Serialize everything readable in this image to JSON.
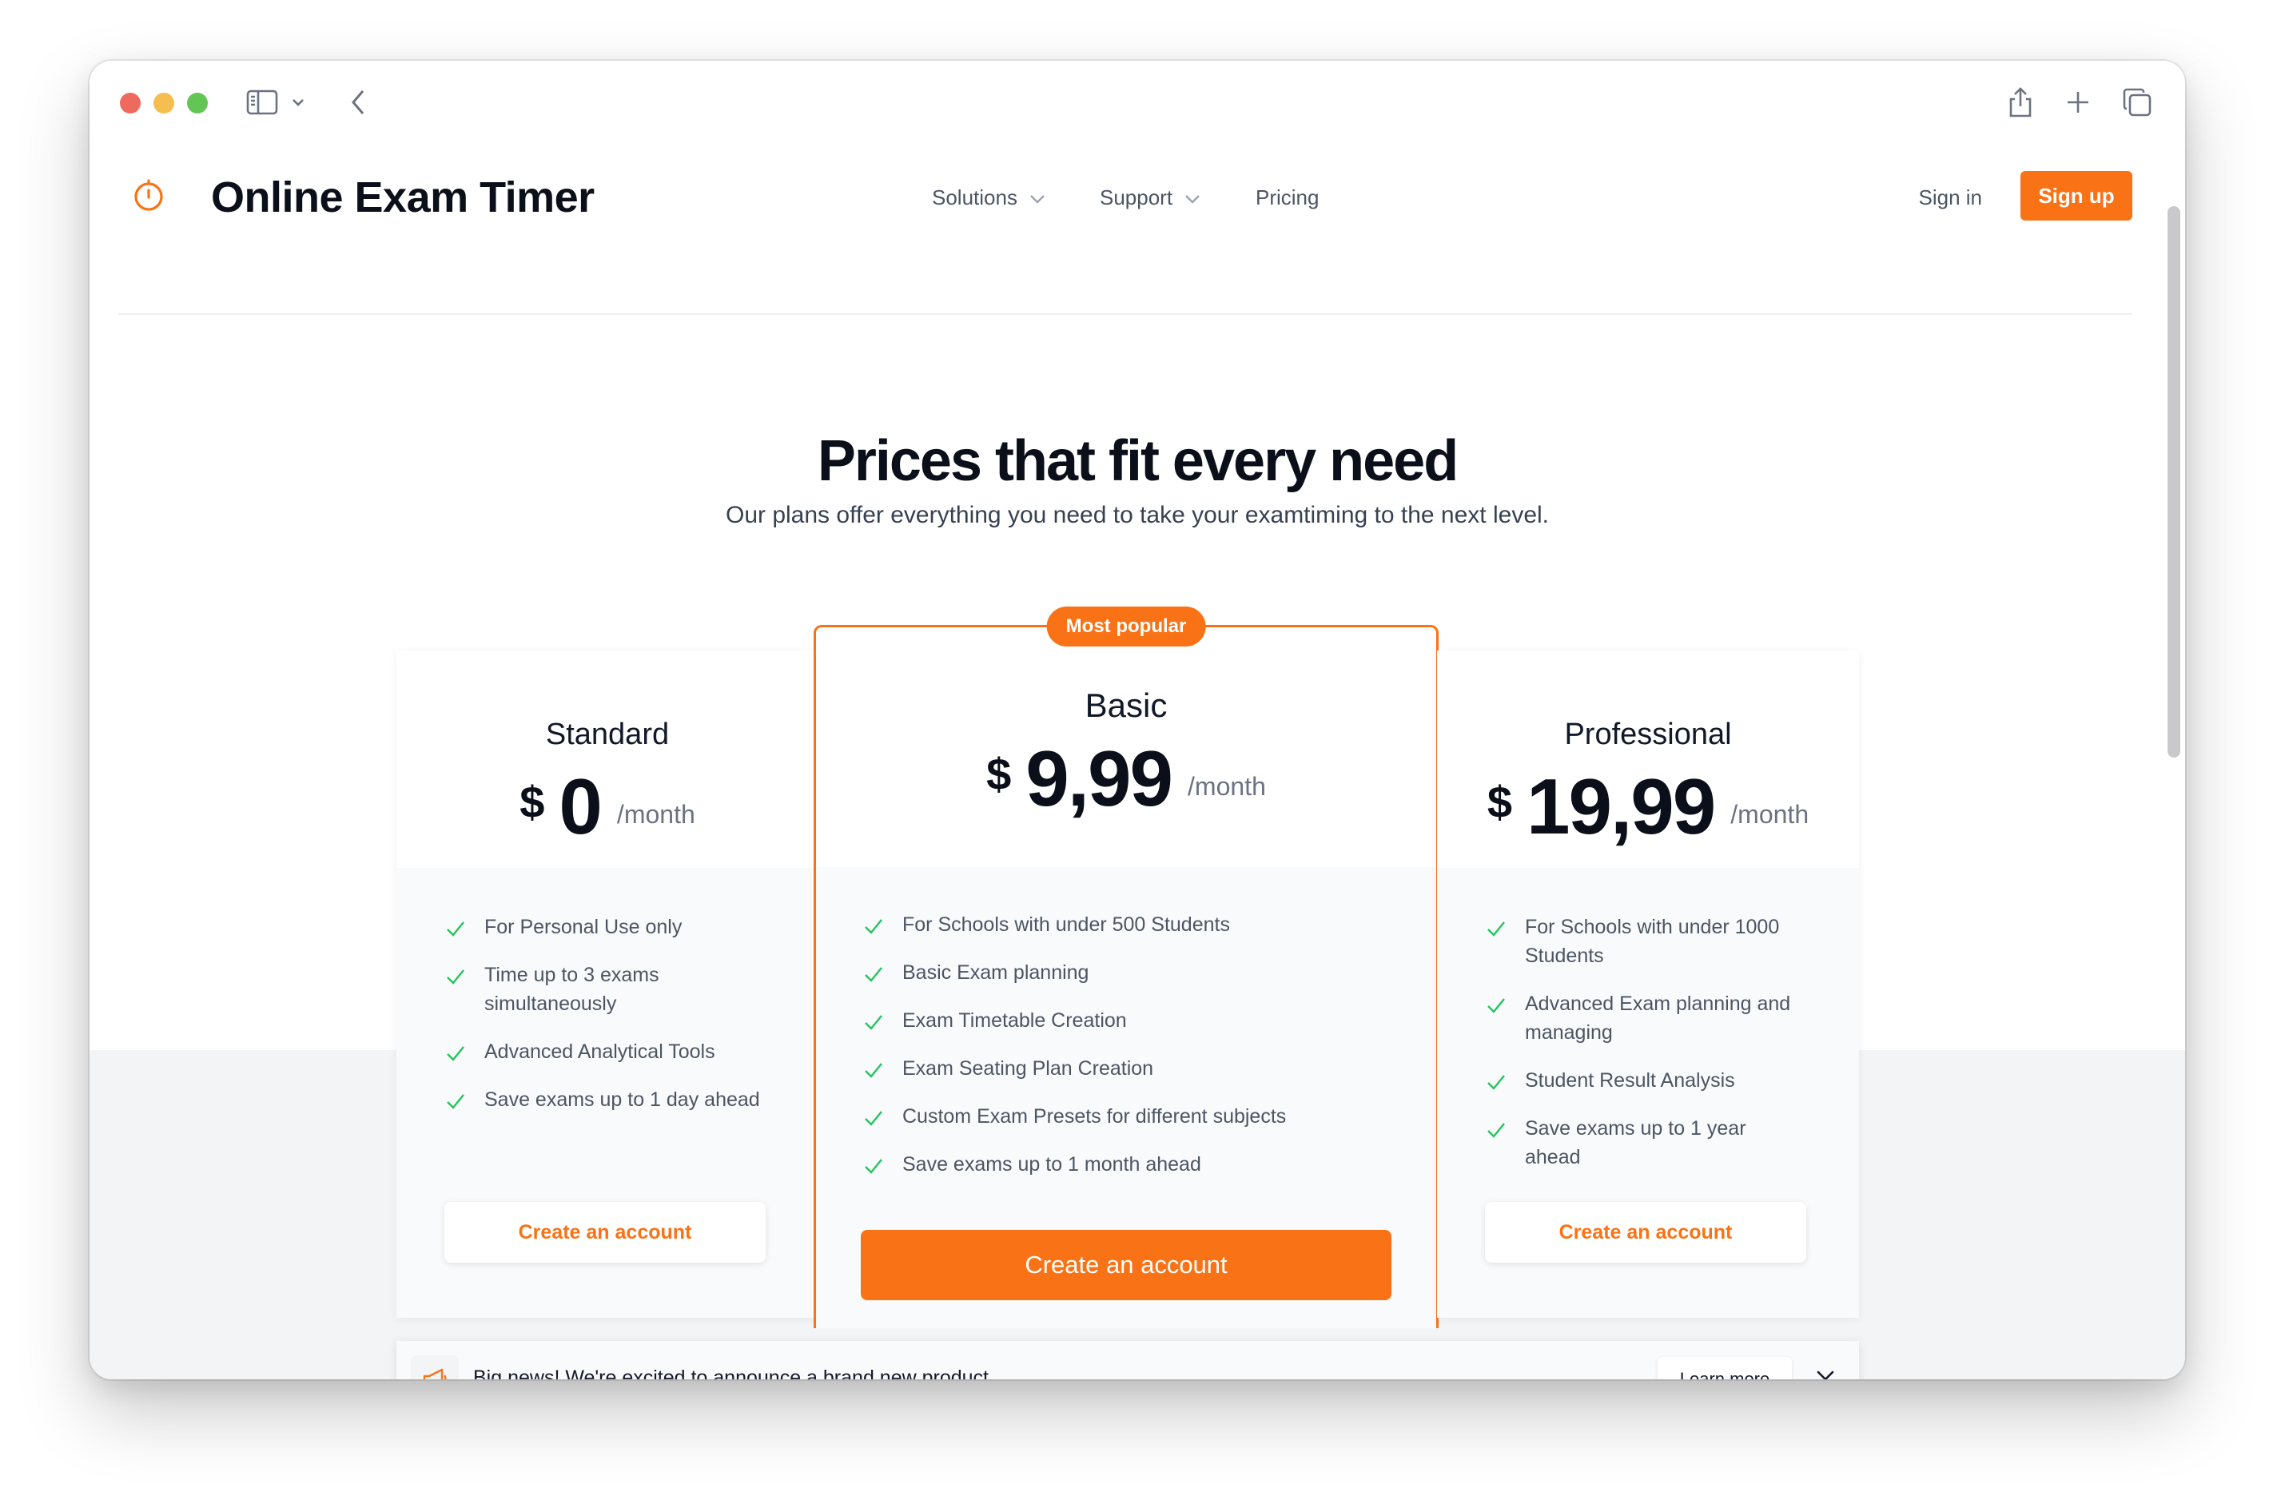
{
  "brand": {
    "name": "Online Exam Timer",
    "accent": "#f97316"
  },
  "nav": {
    "items": [
      {
        "label": "Solutions",
        "has_dropdown": true
      },
      {
        "label": "Support",
        "has_dropdown": true
      },
      {
        "label": "Pricing",
        "has_dropdown": false
      }
    ],
    "sign_in": "Sign in",
    "sign_up": "Sign up"
  },
  "hero": {
    "title": "Prices that fit every need",
    "subtitle": "Our plans offer everything you need to take your examtiming to the next level."
  },
  "plans": [
    {
      "name": "Standard",
      "currency": "$",
      "price": "0",
      "period": "/month",
      "features": [
        "For Personal Use only",
        "Time up to 3 exams simultaneously",
        "Advanced Analytical Tools",
        "Save exams up to 1 day ahead"
      ],
      "cta": "Create an account"
    },
    {
      "name": "Basic",
      "badge": "Most popular",
      "currency": "$",
      "price": "9,99",
      "period": "/month",
      "features": [
        "For Schools with under 500 Students",
        "Basic Exam planning",
        "Exam Timetable Creation",
        "Exam Seating Plan Creation",
        "Custom Exam Presets for different subjects",
        "Save exams up to 1 month ahead"
      ],
      "cta": "Create an account"
    },
    {
      "name": "Professional",
      "currency": "$",
      "price": "19,99",
      "period": "/month",
      "features": [
        "For Schools with under 1000 Students",
        "Advanced Exam planning and managing",
        "Student Result Analysis",
        "Save exams up to 1 year ahead"
      ],
      "cta": "Create an account"
    }
  ],
  "banner": {
    "text": "Big news! We're excited to announce a brand new product.",
    "learn_more": "Learn more"
  },
  "icons": {
    "logo": "stopwatch-icon",
    "feature": "check-icon",
    "banner": "megaphone-icon",
    "close": "close-icon"
  }
}
